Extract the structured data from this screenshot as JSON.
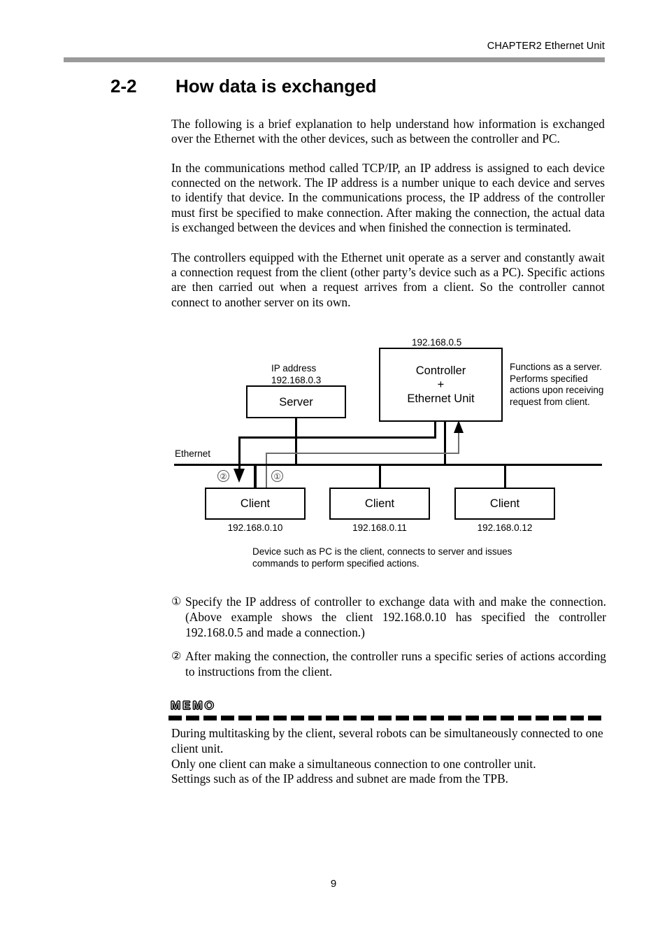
{
  "header": {
    "chapter": "CHAPTER2  Ethernet Unit"
  },
  "title": {
    "number": "2-2",
    "text": "How data is exchanged"
  },
  "paragraphs": {
    "p1": "The following is a brief explanation to help understand how information is exchanged over the Ethernet with the other devices, such as between the controller and PC.",
    "p2": "In the communications method called TCP/IP, an IP address is assigned to each device connected on the network. The IP address is a number unique to each device and serves to identify that device. In the communications process, the IP address of the controller must first be specified to make connection. After making the connection, the actual data is exchanged between the devices and when finished the connection is terminated.",
    "p3": "The controllers equipped with the Ethernet unit operate as a server and constantly await a connection request from the client (other party’s device such as a PC). Specific actions are then carried out when a request arrives from a client. So the controller cannot connect to another server on its own."
  },
  "diagram": {
    "controller_ip": "192.168.0.5",
    "controller_box": "Controller\n+\nEthernet Unit",
    "controller_note": "Functions as a server.\nPerforms specified\nactions upon receiving\nrequest from client.",
    "server_ip_label": "IP address\n192.168.0.3",
    "server_box": "Server",
    "bus_label": "Ethernet",
    "step1_marker": "①",
    "step2_marker": "②",
    "clients": [
      {
        "box": "Client",
        "ip": "192.168.0.10"
      },
      {
        "box": "Client",
        "ip": "192.168.0.11"
      },
      {
        "box": "Client",
        "ip": "192.168.0.12"
      }
    ],
    "caption": "Device such as PC is the client, connects to server and issues\ncommands to perform specified actions."
  },
  "steps": [
    {
      "marker": "①",
      "text": "Specify the IP address of controller to exchange data with and make the connection. (Above example shows the client 192.168.0.10 has specified the controller 192.168.0.5 and made a connection.)"
    },
    {
      "marker": "②",
      "text": "After making the connection, the controller runs a specific series of actions according to instructions from the client."
    }
  ],
  "memo": {
    "title": "MEMO",
    "lines": "During multitasking by the client, several robots can be simultaneously connected to one client unit.\nOnly one client can make a simultaneous connection to one controller unit.\nSettings such as of the IP address and subnet are made from the TPB."
  },
  "footer": {
    "page_number": "9"
  },
  "colors": {
    "header_rule": "#9a9a9a",
    "ink": "#000000",
    "thin_line": "#6e6e6e"
  }
}
